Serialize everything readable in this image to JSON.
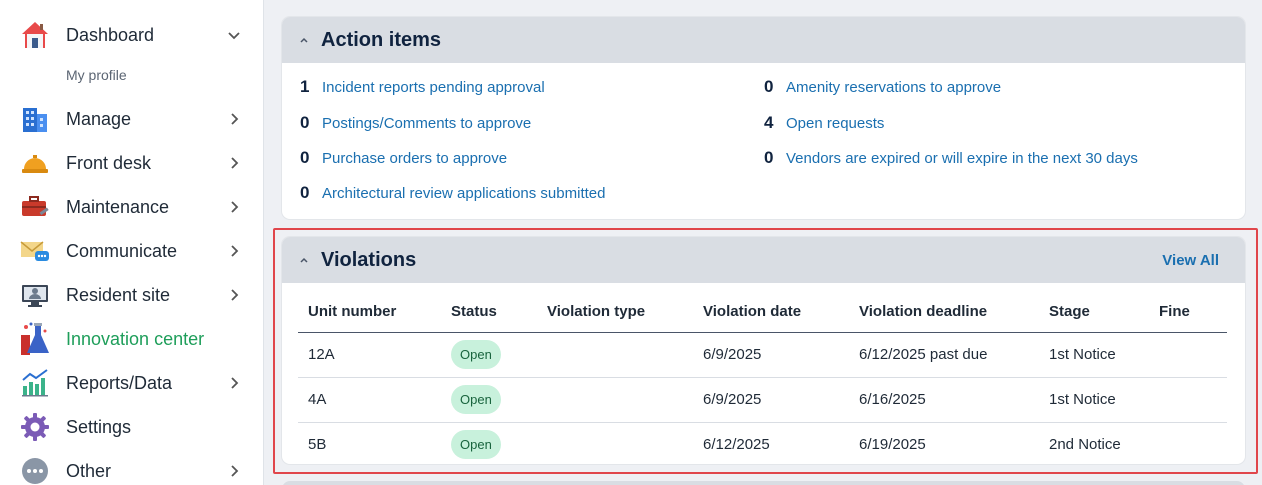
{
  "sidebar": {
    "items": [
      {
        "label": "Dashboard",
        "icon": "house-icon",
        "chevron": "down"
      },
      {
        "label": "Manage",
        "icon": "building-icon",
        "chevron": "right"
      },
      {
        "label": "Front desk",
        "icon": "service-bell-icon",
        "chevron": "right"
      },
      {
        "label": "Maintenance",
        "icon": "toolbox-icon",
        "chevron": "right"
      },
      {
        "label": "Communicate",
        "icon": "envelope-chat-icon",
        "chevron": "right"
      },
      {
        "label": "Resident site",
        "icon": "monitor-user-icon",
        "chevron": "right"
      },
      {
        "label": "Innovation center",
        "icon": "lab-flask-icon",
        "chevron": ""
      },
      {
        "label": "Reports/Data",
        "icon": "bar-chart-icon",
        "chevron": "right"
      },
      {
        "label": "Settings",
        "icon": "gear-icon",
        "chevron": ""
      },
      {
        "label": "Other",
        "icon": "more-dots-icon",
        "chevron": "right"
      }
    ],
    "sub_items": [
      {
        "label": "My profile"
      }
    ],
    "active_color": "#1e9e5a"
  },
  "action_items": {
    "title": "Action items",
    "left": [
      {
        "count": "1",
        "label": "Incident reports pending approval"
      },
      {
        "count": "0",
        "label": "Postings/Comments to approve"
      },
      {
        "count": "0",
        "label": "Purchase orders to approve"
      },
      {
        "count": "0",
        "label": "Architectural review applications submitted"
      }
    ],
    "right": [
      {
        "count": "0",
        "label": "Amenity reservations to approve"
      },
      {
        "count": "4",
        "label": "Open requests"
      },
      {
        "count": "0",
        "label": "Vendors are expired or will expire in the next 30 days"
      }
    ]
  },
  "violations": {
    "title": "Violations",
    "view_all": "View All",
    "columns": [
      "Unit number",
      "Status",
      "Violation type",
      "Violation date",
      "Violation deadline",
      "Stage",
      "Fine"
    ],
    "rows": [
      {
        "unit": "12A",
        "status": "Open",
        "type": "",
        "date": "6/9/2025",
        "deadline": "6/12/2025 past due",
        "past_due": true,
        "stage": "1st Notice",
        "fine": ""
      },
      {
        "unit": "4A",
        "status": "Open",
        "type": "",
        "date": "6/9/2025",
        "deadline": "6/16/2025",
        "past_due": false,
        "stage": "1st Notice",
        "fine": ""
      },
      {
        "unit": "5B",
        "status": "Open",
        "type": "",
        "date": "6/12/2025",
        "deadline": "6/19/2025",
        "past_due": false,
        "stage": "2nd Notice",
        "fine": ""
      }
    ],
    "colors": {
      "past_due": "#c0392b",
      "open_badge_bg": "#c8f1dc",
      "highlight_border": "#e0464b"
    }
  }
}
